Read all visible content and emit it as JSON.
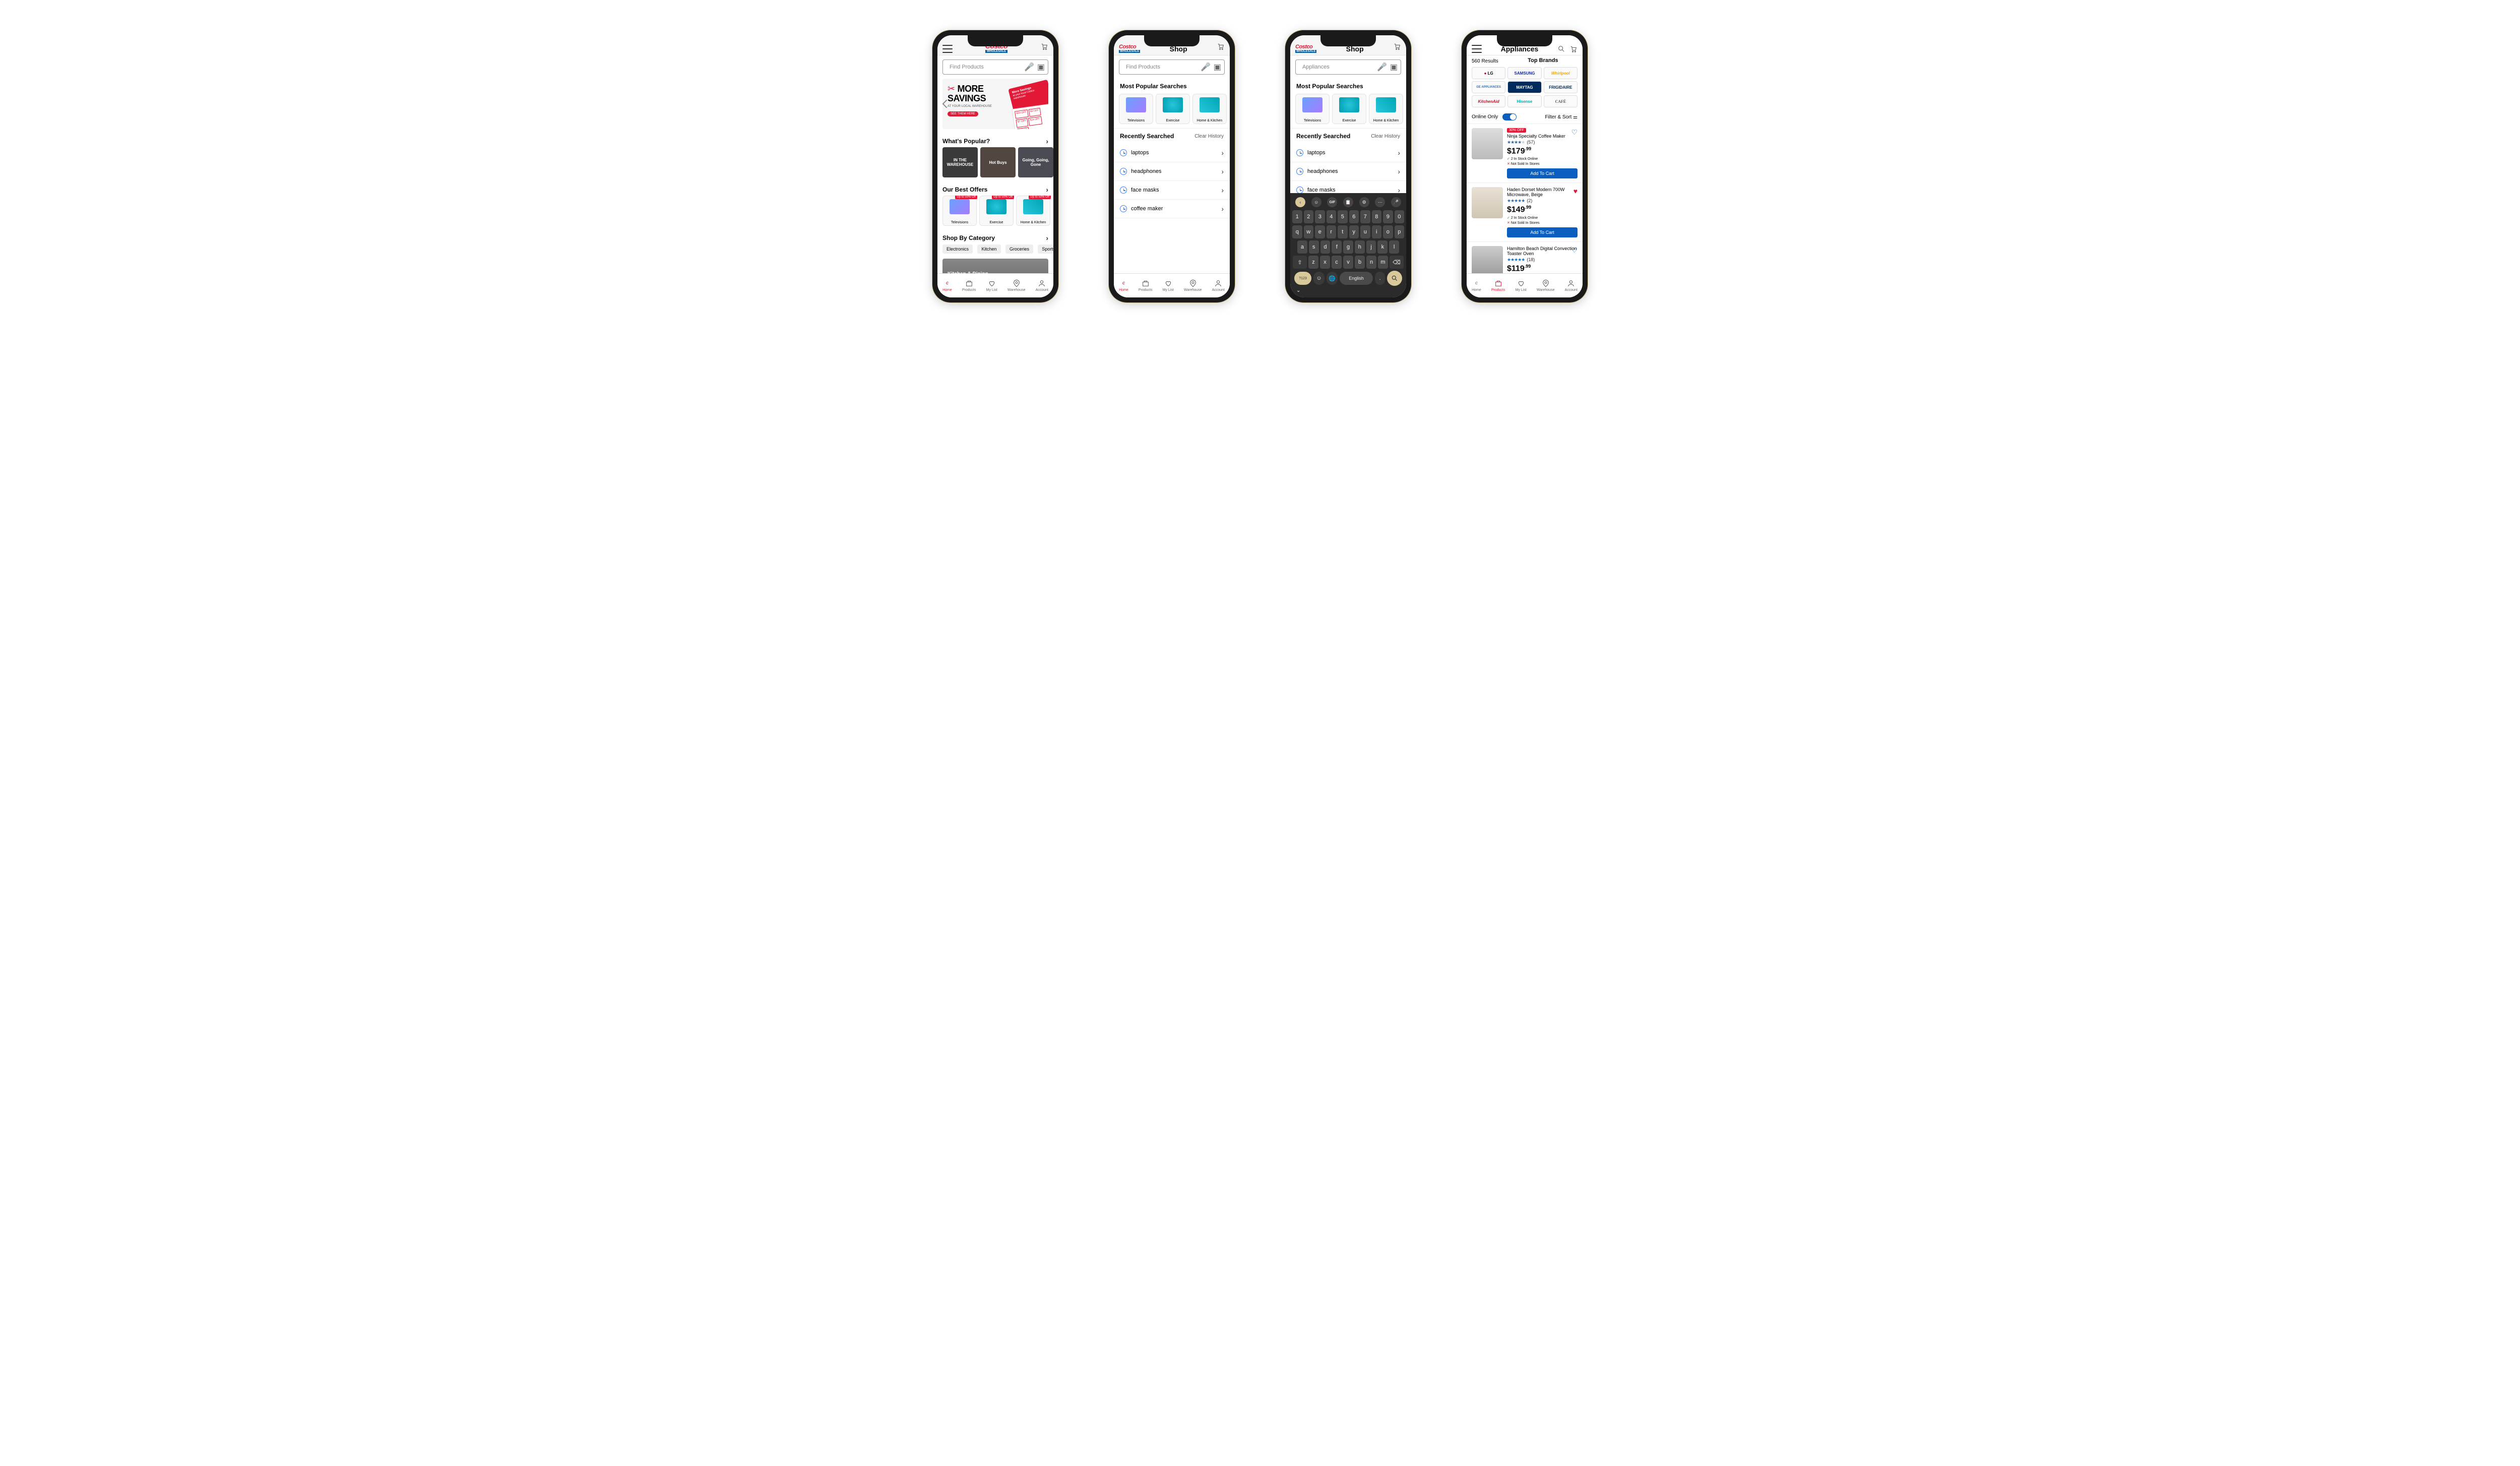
{
  "brand": {
    "name_part1": "Costco",
    "name_part2": "WHOLESALE"
  },
  "search": {
    "placeholder": "Find Products",
    "typed": "Appliances"
  },
  "screen1": {
    "hero": {
      "line1": "MORE",
      "line2": "SAVINGS",
      "sub": "AT YOUR LOCAL WAREHOUSE",
      "cta": "SEE THEM HERE",
      "coupon_title": "More Savings",
      "coupon_sub": "at your local Costco warehouse",
      "tags": [
        "$10 OFF",
        "$3 OFF",
        "$7 OFF",
        "$24 OFF",
        "$5 OFF"
      ]
    },
    "whats_popular": {
      "title": "What's Popular?",
      "items": [
        "IN THE WAREHOUSE",
        "Hot Buys",
        "Going, Going, Gone"
      ]
    },
    "best_offers": {
      "title": "Our Best Offers",
      "items": [
        {
          "label": "Televisions",
          "badge": "Up to 50% Off"
        },
        {
          "label": "Exercise",
          "badge": "Up to 50% Off"
        },
        {
          "label": "Home & Kitchen",
          "badge": "Up to 50% Off"
        }
      ]
    },
    "shop_by_category": {
      "title": "Shop By Category",
      "chips": [
        "Electronics",
        "Kitchen",
        "Groceries",
        "Sports"
      ]
    },
    "kd_banner": "Kitchen & Dining"
  },
  "screen2": {
    "title": "Shop",
    "popular_title": "Most Popular Searches",
    "popular": [
      {
        "label": "Televisions"
      },
      {
        "label": "Exercise"
      },
      {
        "label": "Home & Kitchen"
      }
    ],
    "recent_title": "Recently Searched",
    "clear": "Clear History",
    "recent": [
      "laptops",
      "headphones",
      "face masks",
      "coffee maker"
    ]
  },
  "screen3": {
    "title": "Shop",
    "keyboard_lang": "English",
    "numbers_key": "?123",
    "recent_visible": [
      "laptops",
      "headphones",
      "face masks"
    ]
  },
  "screen4": {
    "title": "Appliances",
    "results": "560 Results",
    "top_brands_title": "Top Brands",
    "brands": [
      "LG",
      "SAMSUNG",
      "Whirlpool",
      "GE APPLIANCES",
      "MAYTAG",
      "FRIGIDAIRE",
      "KitchenAid",
      "Hisense",
      "CAFÉ"
    ],
    "online_only": "Online Only",
    "filter_sort": "Filter & Sort",
    "products": [
      {
        "discount": "30% OFF",
        "name": "Ninja Specialty Coffee Maker",
        "stars": 4,
        "reviews": "(57)",
        "price": "$179",
        "cents": ".99",
        "stock_good": "2 In Stock Online",
        "stock_bad": "Not Sold In Stores",
        "cta": "Add To Cart",
        "fav": "outline"
      },
      {
        "name": "Haden Dorset Modern 700W Microwave, Beige",
        "stars": 5,
        "reviews": "(2)",
        "price": "$149",
        "cents": ".99",
        "stock_good": "2 In Stock Online",
        "stock_bad": "Not Sold In Stores",
        "cta": "Add To Cart",
        "fav": "filled"
      },
      {
        "name": "Hamilton Beach Digital Convection Toaster Oven",
        "stars": 5,
        "reviews": "(18)",
        "price": "$119",
        "cents": ".99",
        "fav": "outline"
      }
    ]
  },
  "nav": {
    "items": [
      "Home",
      "Products",
      "My List",
      "Warehouse",
      "Account"
    ]
  }
}
